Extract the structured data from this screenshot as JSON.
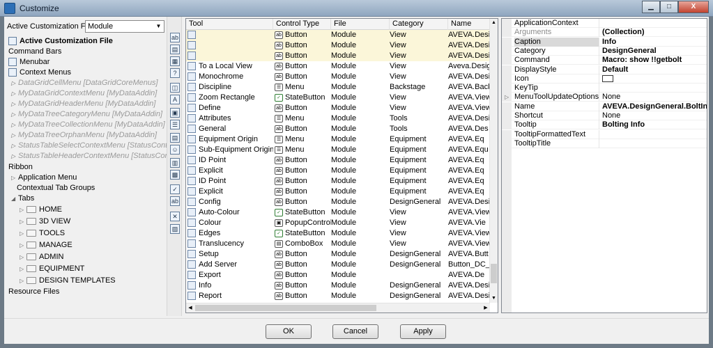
{
  "window": {
    "title": "Customize",
    "min_label": "▁",
    "max_label": "□",
    "close_label": "X"
  },
  "left": {
    "acf_label": "Active Customization File",
    "acf_value": "Module",
    "acf_arrow": "▼",
    "tree": [
      {
        "label": "Active Customization File",
        "style": "bold",
        "icon": "file-icon",
        "exp": ""
      },
      {
        "label": "Command Bars",
        "style": "",
        "icon": "",
        "exp": ""
      },
      {
        "label": "Menubar",
        "style": "",
        "icon": "menubar-icon",
        "exp": ""
      },
      {
        "label": "Context Menus",
        "style": "",
        "icon": "context-menu-icon",
        "exp": ""
      },
      {
        "label": "DataGridCellMenu [DataGridCoreMenus]",
        "style": "dim",
        "icon": "",
        "exp": "▷"
      },
      {
        "label": "MyDataGridContextMenu [MyDataAddin]",
        "style": "dim",
        "icon": "",
        "exp": "▷"
      },
      {
        "label": "MyDataGridHeaderMenu [MyDataAddin]",
        "style": "dim",
        "icon": "",
        "exp": "▷"
      },
      {
        "label": "MyDataTreeCategoryMenu [MyDataAddin]",
        "style": "dim",
        "icon": "",
        "exp": "▷"
      },
      {
        "label": "MyDataTreeCollectionMenu [MyDataAddin]",
        "style": "dim",
        "icon": "",
        "exp": "▷"
      },
      {
        "label": "MyDataTreeOrphanMenu [MyDataAddin]",
        "style": "dim",
        "icon": "",
        "exp": "▷"
      },
      {
        "label": "StatusTableSelectContextMenu [StatusContr",
        "style": "dim",
        "icon": "",
        "exp": "▷"
      },
      {
        "label": "StatusTableHeaderContextMenu [StatusCont",
        "style": "dim",
        "icon": "",
        "exp": "▷"
      },
      {
        "label": "Ribbon",
        "style": "",
        "icon": "",
        "exp": ""
      },
      {
        "label": "Application Menu",
        "style": "",
        "icon": "",
        "exp": "▷"
      },
      {
        "label": "Contextual Tab Groups",
        "style": "",
        "icon": "",
        "exp": ""
      },
      {
        "label": "Tabs",
        "style": "",
        "icon": "",
        "exp": "◢"
      },
      {
        "label": "HOME",
        "style": "",
        "icon": "folder",
        "exp": "▷"
      },
      {
        "label": "3D VIEW",
        "style": "",
        "icon": "folder",
        "exp": "▷"
      },
      {
        "label": "TOOLS",
        "style": "",
        "icon": "folder",
        "exp": "▷"
      },
      {
        "label": "MANAGE",
        "style": "",
        "icon": "folder",
        "exp": "▷"
      },
      {
        "label": "ADMIN",
        "style": "",
        "icon": "folder",
        "exp": "▷"
      },
      {
        "label": "EQUIPMENT",
        "style": "",
        "icon": "folder",
        "exp": "▷"
      },
      {
        "label": "DESIGN TEMPLATES",
        "style": "",
        "icon": "folder",
        "exp": "▷"
      },
      {
        "label": "Resource Files",
        "style": "",
        "icon": "",
        "exp": ""
      }
    ]
  },
  "strip": [
    {
      "glyph": "ab",
      "name": "button-tool-icon"
    },
    {
      "glyph": "▤",
      "name": "statebutton-tool-icon"
    },
    {
      "glyph": "▦",
      "name": "menu-tool-icon"
    },
    {
      "glyph": "?",
      "name": "popup-tool-icon"
    },
    {
      "glyph": "◫",
      "name": "combobox-tool-icon"
    },
    {
      "glyph": "A",
      "name": "label-tool-icon"
    },
    {
      "glyph": "▣",
      "name": "gallery-tool-icon"
    },
    {
      "glyph": "☰",
      "name": "list-tool-icon"
    },
    {
      "glyph": "▤",
      "name": "textbox-tool-icon"
    },
    {
      "glyph": "☺",
      "name": "image-tool-icon"
    },
    {
      "glyph": "▥",
      "name": "grid-tool-icon"
    },
    {
      "glyph": "▩",
      "name": "mdi-tool-icon"
    },
    {
      "glyph": "✓",
      "name": "checkbox-tool-icon"
    },
    {
      "glyph": "ab",
      "name": "text-tool-icon"
    },
    {
      "glyph": "✕",
      "name": "delete-tool-icon"
    },
    {
      "glyph": "▨",
      "name": "picture-tool-icon"
    }
  ],
  "grid": {
    "headers": {
      "tool": "Tool",
      "ct": "Control Type",
      "file": "File",
      "cat": "Category",
      "name": "Name"
    },
    "scroll_up": "▲",
    "scroll_down": "▼",
    "scroll_left": "◀",
    "scroll_right": "▶",
    "rows": [
      {
        "tool": "",
        "ct_icon": "ab",
        "ct": "Button",
        "file": "Module",
        "cat": "View",
        "name": "AVEVA.Desi",
        "sel": true
      },
      {
        "tool": "",
        "ct_icon": "ab",
        "ct": "Button",
        "file": "Module",
        "cat": "View",
        "name": "AVEVA.Desi",
        "sel": true
      },
      {
        "tool": "",
        "ct_icon": "ab",
        "ct": "Button",
        "file": "Module",
        "cat": "View",
        "name": "AVEVA.Desi",
        "sel": true
      },
      {
        "tool": "To a Local View",
        "ct_icon": "ab",
        "ct": "Button",
        "file": "Module",
        "cat": "View",
        "name": "Aveva.Desig",
        "sel": false
      },
      {
        "tool": "Monochrome",
        "ct_icon": "ab",
        "ct": "Button",
        "file": "Module",
        "cat": "View",
        "name": "AVEVA.Desig",
        "sel": false
      },
      {
        "tool": "Discipline",
        "ct_icon": "☰",
        "ct": "Menu",
        "file": "Module",
        "cat": "Backstage",
        "name": "AVEVA.Back",
        "sel": false
      },
      {
        "tool": "Zoom Rectangle",
        "ct_icon": "✓",
        "ct": "StateButton",
        "file": "Module",
        "cat": "View",
        "name": "AVEVA.View",
        "sel": false
      },
      {
        "tool": "Define",
        "ct_icon": "ab",
        "ct": "Button",
        "file": "Module",
        "cat": "View",
        "name": "AVEVA.View",
        "sel": false
      },
      {
        "tool": "Attributes",
        "ct_icon": "☰",
        "ct": "Menu",
        "file": "Module",
        "cat": "Tools",
        "name": "AVEVA.Desi",
        "sel": false
      },
      {
        "tool": "General",
        "ct_icon": "ab",
        "ct": "Button",
        "file": "Module",
        "cat": "Tools",
        "name": "AVEVA.Des",
        "sel": false
      },
      {
        "tool": "Equipment Origin",
        "ct_icon": "☰",
        "ct": "Menu",
        "file": "Module",
        "cat": "Equipment",
        "name": "AVEVA.Eq",
        "sel": false
      },
      {
        "tool": "Sub-Equipment Origin",
        "ct_icon": "☰",
        "ct": "Menu",
        "file": "Module",
        "cat": "Equipment",
        "name": "AVEVA.Equ",
        "sel": false
      },
      {
        "tool": "ID Point",
        "ct_icon": "ab",
        "ct": "Button",
        "file": "Module",
        "cat": "Equipment",
        "name": "AVEVA.Eq",
        "sel": false
      },
      {
        "tool": "Explicit",
        "ct_icon": "ab",
        "ct": "Button",
        "file": "Module",
        "cat": "Equipment",
        "name": "AVEVA.Eq",
        "sel": false
      },
      {
        "tool": "ID Point",
        "ct_icon": "ab",
        "ct": "Button",
        "file": "Module",
        "cat": "Equipment",
        "name": "AVEVA.Eq",
        "sel": false
      },
      {
        "tool": "Explicit",
        "ct_icon": "ab",
        "ct": "Button",
        "file": "Module",
        "cat": "Equipment",
        "name": "AVEVA.Eq",
        "sel": false
      },
      {
        "tool": "Config",
        "ct_icon": "ab",
        "ct": "Button",
        "file": "Module",
        "cat": "DesignGeneral",
        "name": "AVEVA.Desi",
        "sel": false
      },
      {
        "tool": "Auto-Colour",
        "ct_icon": "✓",
        "ct": "StateButton",
        "file": "Module",
        "cat": "View",
        "name": "AVEVA.View",
        "sel": false
      },
      {
        "tool": "Colour",
        "ct_icon": "▣",
        "ct": "PopupControl...",
        "file": "Module",
        "cat": "View",
        "name": "AVEVA.Vie",
        "sel": false
      },
      {
        "tool": "Edges",
        "ct_icon": "✓",
        "ct": "StateButton",
        "file": "Module",
        "cat": "View",
        "name": "AVEVA.View",
        "sel": false
      },
      {
        "tool": "Translucency",
        "ct_icon": "▤",
        "ct": "ComboBox",
        "file": "Module",
        "cat": "View",
        "name": "AVEVA.View",
        "sel": false
      },
      {
        "tool": "Setup",
        "ct_icon": "ab",
        "ct": "Button",
        "file": "Module",
        "cat": "DesignGeneral",
        "name": "AVEVA.Butt",
        "sel": false
      },
      {
        "tool": "Add Server",
        "ct_icon": "ab",
        "ct": "Button",
        "file": "Module",
        "cat": "DesignGeneral",
        "name": "Button_DC_",
        "sel": false
      },
      {
        "tool": "Export",
        "ct_icon": "ab",
        "ct": "Button",
        "file": "Module",
        "cat": "",
        "name": "AVEVA.De",
        "sel": false
      },
      {
        "tool": "Info",
        "ct_icon": "ab",
        "ct": "Button",
        "file": "Module",
        "cat": "DesignGeneral",
        "name": "AVEVA.Desi",
        "sel": false
      },
      {
        "tool": "Report",
        "ct_icon": "ab",
        "ct": "Button",
        "file": "Module",
        "cat": "DesignGeneral",
        "name": "AVEVA.Desi",
        "sel": false
      }
    ]
  },
  "props": [
    {
      "name": "ApplicationContext",
      "value": "",
      "bold": false,
      "dim": false,
      "sel": false,
      "exp": ""
    },
    {
      "name": "Arguments",
      "value": "(Collection)",
      "bold": true,
      "dim": true,
      "sel": false,
      "exp": ""
    },
    {
      "name": "Caption",
      "value": "Info",
      "bold": true,
      "dim": false,
      "sel": true,
      "exp": ""
    },
    {
      "name": "Category",
      "value": "DesignGeneral",
      "bold": true,
      "dim": false,
      "sel": false,
      "exp": ""
    },
    {
      "name": "Command",
      "value": "Macro: show !!getbolt",
      "bold": true,
      "dim": false,
      "sel": false,
      "exp": ""
    },
    {
      "name": "DisplayStyle",
      "value": "Default",
      "bold": true,
      "dim": false,
      "sel": false,
      "exp": ""
    },
    {
      "name": "Icon",
      "value": "",
      "bold": false,
      "dim": false,
      "sel": false,
      "exp": "",
      "iconbox": true
    },
    {
      "name": "KeyTip",
      "value": "",
      "bold": false,
      "dim": false,
      "sel": false,
      "exp": ""
    },
    {
      "name": "MenuToolUpdateOptions",
      "value": "None",
      "bold": false,
      "dim": false,
      "sel": false,
      "exp": "▷"
    },
    {
      "name": "Name",
      "value": "AVEVA.DesignGeneral.BoltInfo",
      "bold": true,
      "dim": false,
      "sel": false,
      "exp": ""
    },
    {
      "name": "Shortcut",
      "value": "None",
      "bold": false,
      "dim": false,
      "sel": false,
      "exp": ""
    },
    {
      "name": "Tooltip",
      "value": "Bolting Info",
      "bold": true,
      "dim": false,
      "sel": false,
      "exp": ""
    },
    {
      "name": "TooltipFormattedText",
      "value": "",
      "bold": false,
      "dim": false,
      "sel": false,
      "exp": ""
    },
    {
      "name": "TooltipTitle",
      "value": "",
      "bold": false,
      "dim": false,
      "sel": false,
      "exp": ""
    }
  ],
  "buttons": {
    "ok": "OK",
    "cancel": "Cancel",
    "apply": "Apply"
  }
}
